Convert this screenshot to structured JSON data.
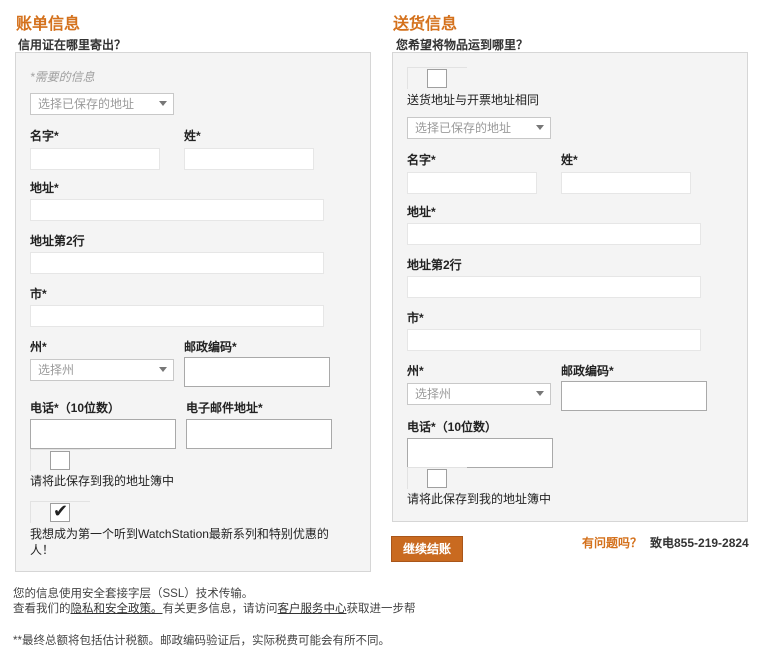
{
  "billing": {
    "title": "账单信息",
    "subtitle": "信用证在哪里寄出？",
    "required_note": "*需要的信息",
    "saved_select": "选择已保存的地址",
    "first_name_label": "名字*",
    "last_name_label": "姓*",
    "address_label": "地址*",
    "address2_label": "地址第2行",
    "city_label": "市*",
    "state_label": "州*",
    "state_select": "选择州",
    "zip_label": "邮政编码*",
    "phone_label": "电话*（10位数）",
    "email_label": "电子邮件地址*",
    "save_checkbox_label": "请将此保存到我的地址簿中",
    "newsletter_line1": "我想成为第一个听到WatchStation最新系列和特别优惠的",
    "newsletter_line2": "人！"
  },
  "shipping": {
    "title": "送货信息",
    "subtitle": "您希望将物品运到哪里？",
    "same_as_billing_label": "送货地址与开票地址相同",
    "saved_select": "选择已保存的地址",
    "first_name_label": "名字*",
    "last_name_label": "姓*",
    "address_label": "地址*",
    "address2_label": "地址第2行",
    "city_label": "市*",
    "state_label": "州*",
    "state_select": "选择州",
    "zip_label": "邮政编码*",
    "phone_label": "电话*（10位数）",
    "save_checkbox_label": "请将此保存到我的地址簿中"
  },
  "continue_button": "继续结账",
  "help": {
    "question": "有问题吗？",
    "phone": "致电855-219-2824"
  },
  "footer": {
    "ssl_text": "您的信息使用安全套接字层（SSL）技术传输。",
    "view_our": "查看我们的",
    "privacy_link": "隐私和安全政策。",
    "more_info": "有关更多信息，请访问",
    "service_link": "客户服务中心",
    "get_help": "获取进一步帮",
    "tax_note": "**最终总额将包括估计税额。邮政编码验证后，实际税费可能会有所不同。"
  }
}
